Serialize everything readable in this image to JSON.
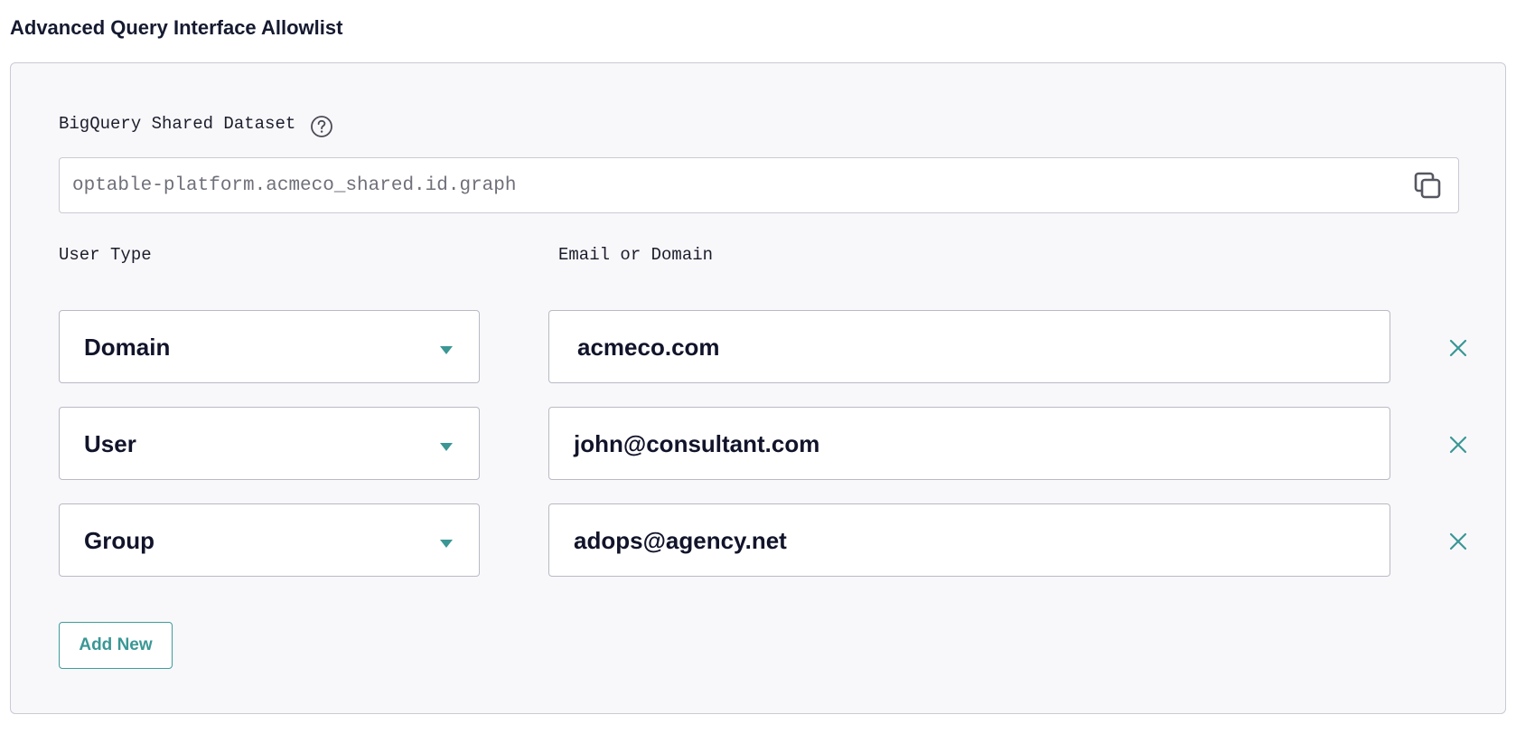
{
  "page": {
    "title": "Advanced Query Interface Allowlist"
  },
  "dataset": {
    "label": "BigQuery Shared Dataset",
    "value": "optable-platform.acmeco_shared.id.graph"
  },
  "columns": {
    "user_type": "User Type",
    "email_or_domain": "Email or Domain"
  },
  "rows": [
    {
      "user_type": "Domain",
      "value": "acmeco.com"
    },
    {
      "user_type": "User",
      "value": "john@consultant.com"
    },
    {
      "user_type": "Group",
      "value": "adops@agency.net"
    }
  ],
  "actions": {
    "add_new": "Add New"
  },
  "icons": {
    "help": "help-circle-icon",
    "copy": "copy-icon",
    "caret": "caret-down-icon",
    "remove": "close-icon"
  },
  "colors": {
    "accent": "#3a9795",
    "panel_bg": "#f8f8fb",
    "border": "#c9cad3",
    "text": "#11142a",
    "muted_text": "#6f7079"
  }
}
